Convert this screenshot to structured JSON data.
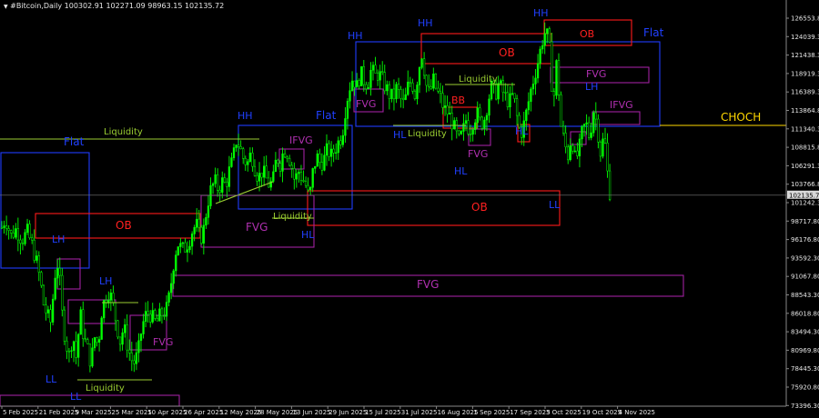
{
  "header": {
    "text": "#Bitcoin,Daily  100302.91 102271.09 98963.15 102135.72",
    "marker_icon": "triangle-down-icon"
  },
  "colors": {
    "background": "#000000",
    "candle": "#00ff00",
    "blue": "#1f3cff",
    "red": "#ff1a1a",
    "purple": "#a020a0",
    "lime": "#9acd32",
    "gold": "#ffd700",
    "text_blue": "#2040ff",
    "text_red": "#ff2020",
    "text_purple": "#b030b0",
    "text_lime": "#9acd32"
  },
  "chart_data": {
    "type": "candlestick",
    "symbol": "#Bitcoin",
    "timeframe": "Daily",
    "last_ohlc": {
      "open": 100302.91,
      "high": 102271.09,
      "low": 98963.15,
      "close": 102135.72
    },
    "current_price_label": "102135.72",
    "price_ticks": [
      "126553.80",
      "124039.30",
      "121438.30",
      "118919.30",
      "116389.30",
      "113864.80",
      "111340.30",
      "108815.80",
      "106291.30",
      "103766.80",
      "101242.30",
      "98717.80",
      "96176.80",
      "93592.30",
      "91067.80",
      "88543.30",
      "86018.80",
      "83494.30",
      "80969.80",
      "78445.30",
      "75920.80",
      "73396.30"
    ],
    "date_ticks": [
      "5 Feb 2025",
      "21 Feb 2025",
      "9 Mar 2025",
      "25 Mar 2025",
      "10 Apr 2025",
      "26 Apr 2025",
      "12 May 2025",
      "28 May 2025",
      "13 Jun 2025",
      "29 Jun 2025",
      "15 Jul 2025",
      "31 Jul 2025",
      "16 Aug 2025",
      "1 Sep 2025",
      "17 Sep 2025",
      "3 Oct 2025",
      "19 Oct 2025",
      "4 Nov 2025"
    ],
    "anchors": [
      [
        0,
        97000
      ],
      [
        6,
        99000
      ],
      [
        12,
        96500
      ],
      [
        18,
        97500
      ],
      [
        24,
        96000
      ],
      [
        30,
        97000
      ],
      [
        36,
        95000
      ],
      [
        40,
        93000
      ],
      [
        44,
        90500
      ],
      [
        48,
        87000
      ],
      [
        52,
        85500
      ],
      [
        56,
        84500
      ],
      [
        60,
        91000
      ],
      [
        64,
        93000
      ],
      [
        68,
        86000
      ],
      [
        72,
        82000
      ],
      [
        76,
        80000
      ],
      [
        80,
        83000
      ],
      [
        84,
        79500
      ],
      [
        88,
        86000
      ],
      [
        92,
        82500
      ],
      [
        96,
        81000
      ],
      [
        100,
        79000
      ],
      [
        104,
        82500
      ],
      [
        108,
        81500
      ],
      [
        112,
        86500
      ],
      [
        116,
        88000
      ],
      [
        120,
        89000
      ],
      [
        124,
        87000
      ],
      [
        128,
        84500
      ],
      [
        132,
        82000
      ],
      [
        136,
        84000
      ],
      [
        140,
        81500
      ],
      [
        144,
        79500
      ],
      [
        148,
        79000
      ],
      [
        152,
        80500
      ],
      [
        156,
        84000
      ],
      [
        160,
        85500
      ],
      [
        164,
        86000
      ],
      [
        168,
        85000
      ],
      [
        172,
        84500
      ],
      [
        176,
        85500
      ],
      [
        180,
        86000
      ],
      [
        184,
        86500
      ],
      [
        188,
        90000
      ],
      [
        192,
        94000
      ],
      [
        196,
        95500
      ],
      [
        200,
        94500
      ],
      [
        204,
        95000
      ],
      [
        208,
        96000
      ],
      [
        212,
        97500
      ],
      [
        216,
        98000
      ],
      [
        220,
        96000
      ],
      [
        224,
        97500
      ],
      [
        228,
        101000
      ],
      [
        232,
        103000
      ],
      [
        236,
        104000
      ],
      [
        240,
        103000
      ],
      [
        244,
        104000
      ],
      [
        248,
        103500
      ],
      [
        252,
        105500
      ],
      [
        256,
        107000
      ],
      [
        260,
        110000
      ],
      [
        264,
        108500
      ],
      [
        268,
        107000
      ],
      [
        272,
        106500
      ],
      [
        276,
        108000
      ],
      [
        280,
        106000
      ],
      [
        284,
        104500
      ],
      [
        288,
        105500
      ],
      [
        292,
        104500
      ],
      [
        296,
        103500
      ],
      [
        300,
        104000
      ],
      [
        304,
        107500
      ],
      [
        308,
        106500
      ],
      [
        312,
        108500
      ],
      [
        316,
        108000
      ],
      [
        320,
        106500
      ],
      [
        324,
        104000
      ],
      [
        328,
        105500
      ],
      [
        332,
        104500
      ],
      [
        336,
        103500
      ],
      [
        340,
        101500
      ],
      [
        344,
        105500
      ],
      [
        348,
        107500
      ],
      [
        352,
        106500
      ],
      [
        356,
        107000
      ],
      [
        360,
        108500
      ],
      [
        364,
        107500
      ],
      [
        368,
        108500
      ],
      [
        372,
        109500
      ],
      [
        376,
        110500
      ],
      [
        380,
        114500
      ],
      [
        384,
        117000
      ],
      [
        388,
        118500
      ],
      [
        392,
        117000
      ],
      [
        396,
        119000
      ],
      [
        400,
        118000
      ],
      [
        404,
        117500
      ],
      [
        408,
        119500
      ],
      [
        412,
        118500
      ],
      [
        416,
        119000
      ],
      [
        420,
        118000
      ],
      [
        424,
        117000
      ],
      [
        428,
        116000
      ],
      [
        432,
        115500
      ],
      [
        436,
        117000
      ],
      [
        440,
        115500
      ],
      [
        444,
        114500
      ],
      [
        448,
        117000
      ],
      [
        452,
        118000
      ],
      [
        456,
        116000
      ],
      [
        460,
        119500
      ],
      [
        464,
        122000
      ],
      [
        468,
        117500
      ],
      [
        472,
        116000
      ],
      [
        476,
        118000
      ],
      [
        480,
        116500
      ],
      [
        484,
        115500
      ],
      [
        488,
        114000
      ],
      [
        492,
        113500
      ],
      [
        496,
        112500
      ],
      [
        500,
        111000
      ],
      [
        504,
        109500
      ],
      [
        508,
        110500
      ],
      [
        512,
        112500
      ],
      [
        516,
        111000
      ],
      [
        520,
        112500
      ],
      [
        524,
        113500
      ],
      [
        528,
        112000
      ],
      [
        532,
        112500
      ],
      [
        536,
        115000
      ],
      [
        540,
        117000
      ],
      [
        544,
        116000
      ],
      [
        548,
        117500
      ],
      [
        552,
        116500
      ],
      [
        556,
        115500
      ],
      [
        560,
        115000
      ],
      [
        564,
        116000
      ],
      [
        568,
        113000
      ],
      [
        572,
        110500
      ],
      [
        576,
        112000
      ],
      [
        580,
        114500
      ],
      [
        584,
        117000
      ],
      [
        588,
        119000
      ],
      [
        592,
        121000
      ],
      [
        596,
        123500
      ],
      [
        600,
        125000
      ],
      [
        604,
        122000
      ],
      [
        608,
        114500
      ],
      [
        612,
        121000
      ],
      [
        616,
        112000
      ],
      [
        620,
        109500
      ],
      [
        624,
        107500
      ],
      [
        628,
        110500
      ],
      [
        632,
        107000
      ],
      [
        636,
        108000
      ],
      [
        640,
        111000
      ],
      [
        644,
        112000
      ],
      [
        648,
        110000
      ],
      [
        652,
        114000
      ],
      [
        656,
        112000
      ],
      [
        660,
        108000
      ],
      [
        664,
        110500
      ],
      [
        668,
        104500
      ],
      [
        672,
        101000
      ]
    ]
  },
  "annotations": {
    "labels": [
      {
        "text": "HH",
        "color": "blue",
        "size": 11
      },
      {
        "text": "HH",
        "color": "blue",
        "size": 11
      },
      {
        "text": "HH",
        "color": "blue",
        "size": 11
      },
      {
        "text": "HH",
        "color": "blue",
        "size": 11
      },
      {
        "text": "LH",
        "color": "blue",
        "size": 11
      },
      {
        "text": "LH",
        "color": "blue",
        "size": 11
      },
      {
        "text": "LH",
        "color": "blue",
        "size": 11
      },
      {
        "text": "LL",
        "color": "blue",
        "size": 11
      },
      {
        "text": "LL",
        "color": "blue",
        "size": 11
      },
      {
        "text": "LL",
        "color": "blue",
        "size": 11
      },
      {
        "text": "HL",
        "color": "blue",
        "size": 11
      },
      {
        "text": "HL",
        "color": "blue",
        "size": 11
      },
      {
        "text": "HL",
        "color": "blue",
        "size": 11
      },
      {
        "text": "HL",
        "color": "blue",
        "size": 11
      },
      {
        "text": "Flat",
        "color": "blue",
        "size": 12
      },
      {
        "text": "Flat",
        "color": "blue",
        "size": 12
      },
      {
        "text": "Flat",
        "color": "blue",
        "size": 12
      },
      {
        "text": "OB",
        "color": "red",
        "size": 12
      },
      {
        "text": "OB",
        "color": "red",
        "size": 12
      },
      {
        "text": "OB",
        "color": "red",
        "size": 12
      },
      {
        "text": "OB",
        "color": "red",
        "size": 11
      },
      {
        "text": "BB",
        "color": "red",
        "size": 11
      },
      {
        "text": "FVG",
        "color": "purple",
        "size": 12
      },
      {
        "text": "FVG",
        "color": "purple",
        "size": 12
      },
      {
        "text": "FVG",
        "color": "purple",
        "size": 11
      },
      {
        "text": "FVG",
        "color": "purple",
        "size": 11
      },
      {
        "text": "FVG",
        "color": "purple",
        "size": 11
      },
      {
        "text": "FVG",
        "color": "purple",
        "size": 11
      },
      {
        "text": "IFVG",
        "color": "purple",
        "size": 11
      },
      {
        "text": "IFVG",
        "color": "purple",
        "size": 11
      },
      {
        "text": "Liquidity",
        "color": "lime",
        "size": 10
      },
      {
        "text": "Liquidity",
        "color": "lime",
        "size": 10
      },
      {
        "text": "Liquidity",
        "color": "lime",
        "size": 10
      },
      {
        "text": "Liquidity",
        "color": "lime",
        "size": 10
      },
      {
        "text": "Liquidity",
        "color": "lime",
        "size": 10
      },
      {
        "text": "CHOCH",
        "color": "gold",
        "size": 12
      }
    ]
  }
}
